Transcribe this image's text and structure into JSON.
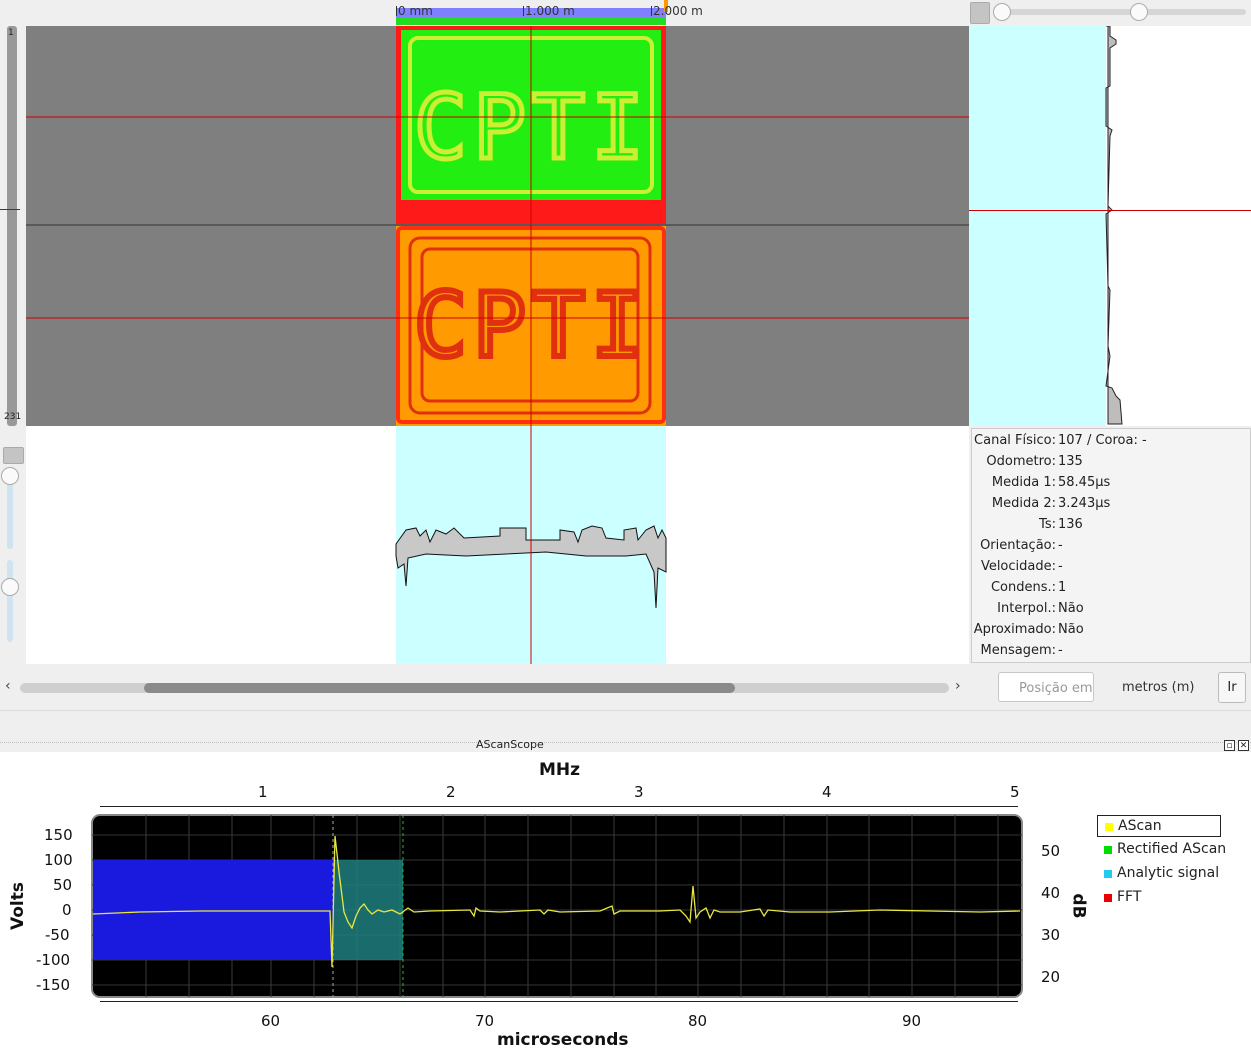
{
  "ruler": {
    "labels": [
      "0 mm",
      "1.000 m",
      "2.000 m"
    ]
  },
  "vertical_scale": {
    "top": "1",
    "bottom": "231"
  },
  "info_panel": {
    "rows": [
      {
        "key": "Canal Físico:",
        "value": "107 / Coroa: -"
      },
      {
        "key": "Odometro:",
        "value": "135"
      },
      {
        "key": "Medida 1:",
        "value": "58.45µs"
      },
      {
        "key": "Medida 2:",
        "value": "3.243µs"
      },
      {
        "key": "Ts:",
        "value": "136"
      },
      {
        "key": "Orientação:",
        "value": "-"
      },
      {
        "key": "Velocidade:",
        "value": "-"
      },
      {
        "key": "Condens.:",
        "value": "1"
      },
      {
        "key": "Interpol.:",
        "value": "Não"
      },
      {
        "key": "Aproximado:",
        "value": "Não"
      },
      {
        "key": "Mensagem:",
        "value": "-"
      }
    ]
  },
  "scan_images": {
    "text": "CPTI",
    "top_colors": {
      "frame": "#ff1a1a",
      "fill": "#22ee11",
      "text": "#ccee33"
    },
    "bottom_colors": {
      "frame": "#ff8800",
      "fill": "#ff9a00",
      "text": "#e03010"
    }
  },
  "navigation": {
    "position_placeholder": "Posição em",
    "unit_label": "metros (m)",
    "go_button": "Ir",
    "scroll_left": "‹",
    "scroll_right": "›"
  },
  "scope": {
    "title": "AScanScope",
    "restore_icon": "restore-icon",
    "close_icon": "close-icon",
    "top_axis_title": "MHz",
    "top_ticks": [
      "1",
      "2",
      "3",
      "4",
      "5"
    ],
    "bottom_axis_title": "microseconds",
    "bottom_ticks": [
      "60",
      "70",
      "80",
      "90"
    ],
    "left_axis_title": "Volts",
    "left_ticks": [
      "150",
      "100",
      "50",
      "0",
      "-50",
      "-100",
      "-150"
    ],
    "right_axis_title": "dB",
    "right_ticks": [
      "50",
      "40",
      "30",
      "20"
    ],
    "legend": [
      {
        "label": "AScan",
        "color": "#ffff00"
      },
      {
        "label": "Rectified AScan",
        "color": "#00dd00"
      },
      {
        "label": "Analytic signal",
        "color": "#22ccee"
      },
      {
        "label": "FFT",
        "color": "#ee0000"
      }
    ]
  }
}
